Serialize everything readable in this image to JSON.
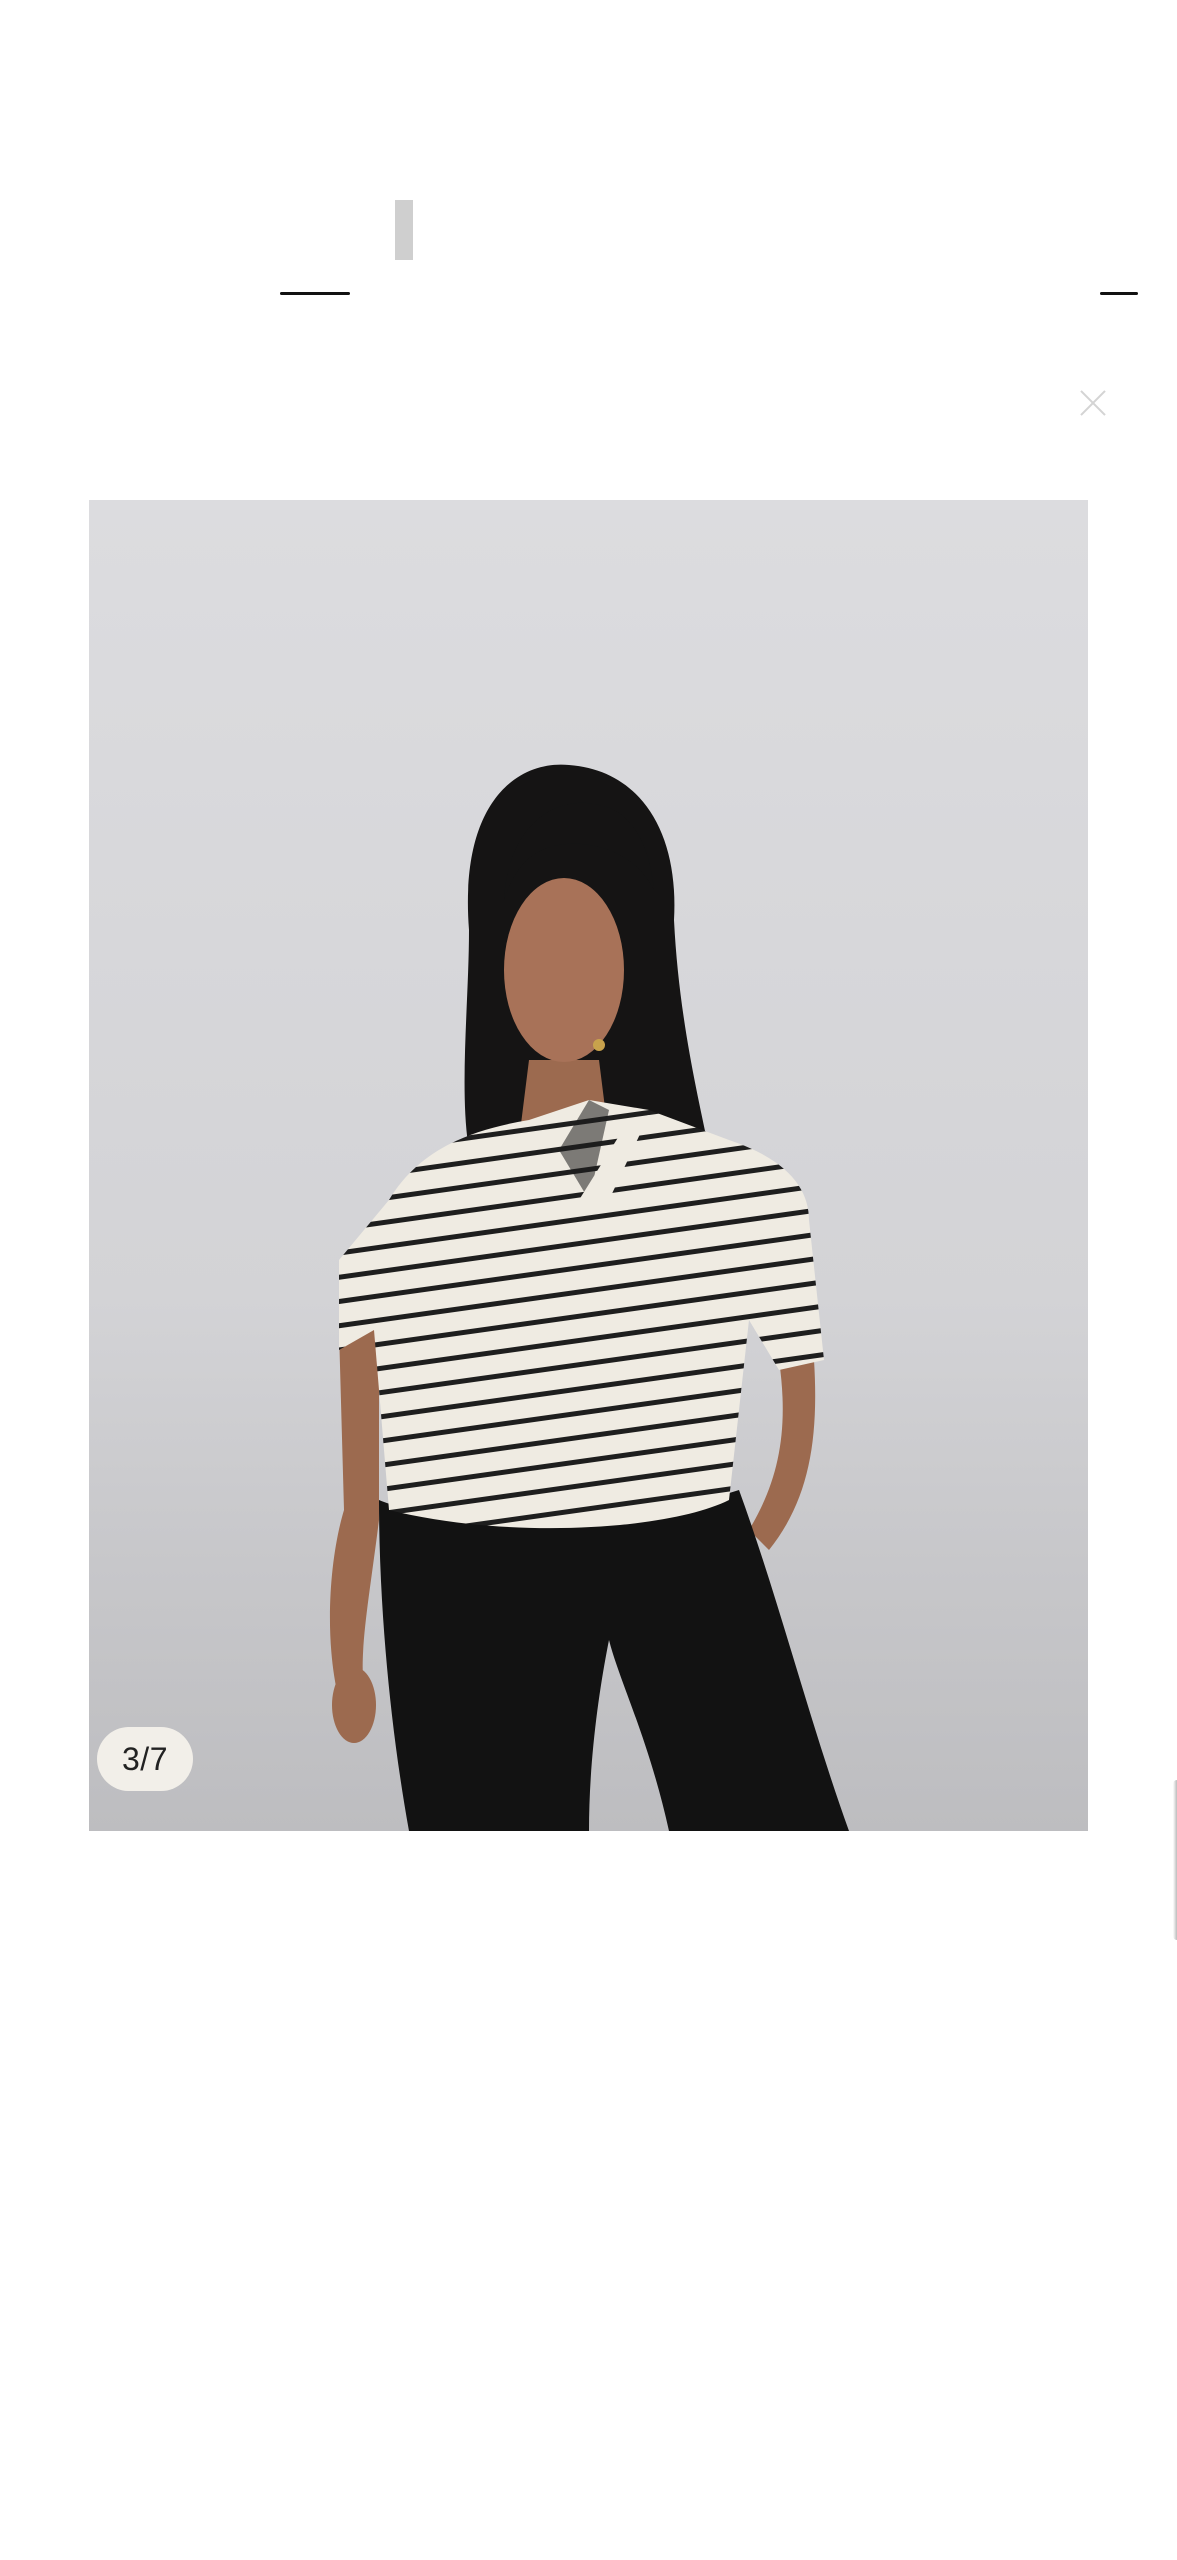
{
  "gallery": {
    "counter_text": "3/7",
    "current_index": 3,
    "total_images": 7
  },
  "photo": {
    "subject": "model-wearing-striped-polo-top-and-black-trousers",
    "shirt_colors": [
      "#efebe2",
      "#1e1e1e"
    ],
    "pants_color": "#121212",
    "background_color": "#d6d6d9"
  },
  "colors": {
    "page_background": "#ffffff",
    "counter_background": "#f2efe9",
    "counter_text": "#222222",
    "close_icon": "#d4d4d4"
  },
  "icons": {
    "close": "close-icon"
  }
}
